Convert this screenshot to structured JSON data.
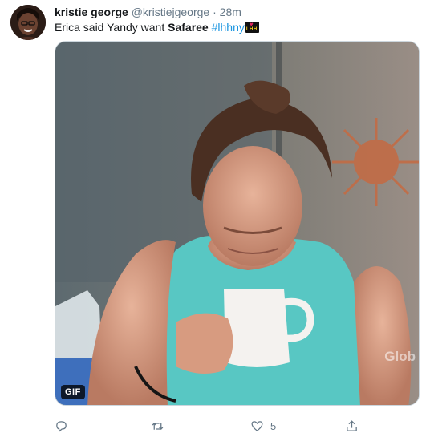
{
  "tweet": {
    "author_name": "kristie george",
    "author_handle": "@kristiejgeorge",
    "separator": "·",
    "time": "28m",
    "text_prefix": "Erica said Yandy want ",
    "text_bold": "Safaree",
    "text_hashtag": "#lhhny",
    "emoji_label": "LHH",
    "media": {
      "badge": "GIF",
      "watermark": "Glob"
    },
    "actions": {
      "reply_icon": "reply-icon",
      "retweet_icon": "retweet-icon",
      "like_icon": "heart-icon",
      "like_count": "5",
      "share_icon": "share-icon"
    }
  },
  "colors": {
    "link": "#1b95e0",
    "muted": "#657786",
    "teal_top": "#56c2c0"
  }
}
